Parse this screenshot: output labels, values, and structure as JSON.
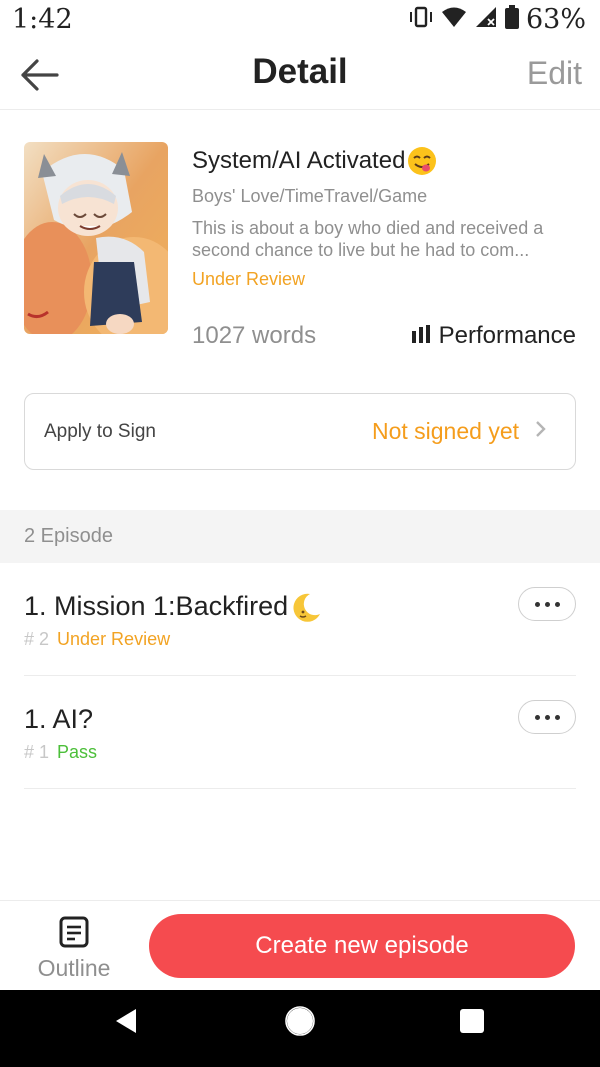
{
  "status_bar": {
    "time": "1:42",
    "battery_percent": "63%",
    "icons": [
      "vibrate-icon",
      "wifi-icon",
      "signal-icon",
      "battery-icon"
    ]
  },
  "header": {
    "title": "Detail",
    "edit_label": "Edit"
  },
  "book": {
    "title": "System/AI Activated",
    "title_emoji": "face-savoring-food-emoji",
    "genre": "Boys' Love/TimeTravel/Game",
    "description": "This is about a boy who died and received a second chance to live but he had to com...",
    "status": "Under Review",
    "words": "1027 words",
    "performance_label": "Performance"
  },
  "sign": {
    "label": "Apply to Sign",
    "status": "Not signed yet"
  },
  "episodes_header": "2 Episode",
  "episodes": [
    {
      "title": "1. Mission 1:Backfired",
      "title_emoji": "crescent-moon-emoji",
      "number": "# 2",
      "status": "Under Review"
    },
    {
      "title": "1. AI?",
      "number": "# 1",
      "status": "Pass"
    }
  ],
  "bottom": {
    "outline_label": "Outline",
    "create_label": "Create new episode"
  },
  "colors": {
    "accent_red": "#f54b4f",
    "review_orange": "#f2a323",
    "pass_green": "#4cbf3a",
    "muted_gray": "#8f8f8f"
  }
}
